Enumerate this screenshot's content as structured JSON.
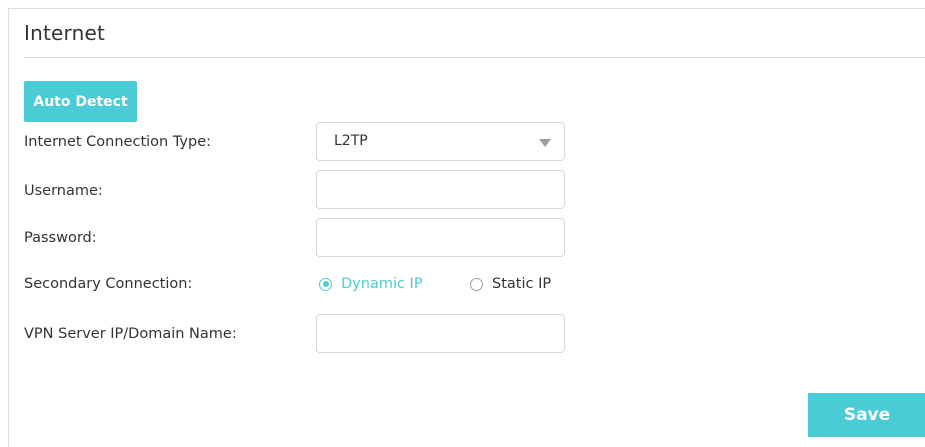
{
  "section": {
    "title": "Internet"
  },
  "auto_detect": {
    "label": "Auto Detect"
  },
  "form": {
    "connection_type": {
      "label": "Internet Connection Type:",
      "value": "L2TP"
    },
    "username": {
      "label": "Username:",
      "value": ""
    },
    "password": {
      "label": "Password:",
      "value": ""
    },
    "secondary_connection": {
      "label": "Secondary Connection:",
      "options": [
        "Dynamic IP",
        "Static IP"
      ],
      "selected": "Dynamic IP"
    },
    "vpn_server": {
      "label": "VPN Server IP/Domain Name:",
      "value": ""
    }
  },
  "save": {
    "label": "Save"
  },
  "colors": {
    "accent": "#4acbd6",
    "border": "#dcdcdc",
    "text": "#333333"
  }
}
